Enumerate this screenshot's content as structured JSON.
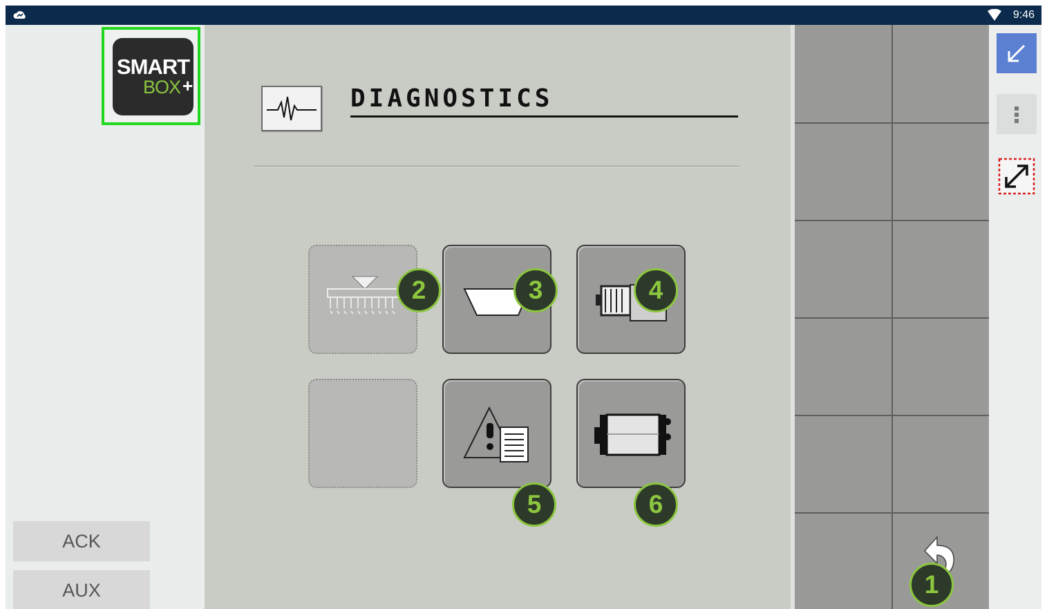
{
  "status_bar": {
    "time": "9:46",
    "cloud_icon": "cloud-icon",
    "wifi_icon": "wifi-icon"
  },
  "logo": {
    "line1": "SMART",
    "line2": "BOX",
    "plus": "+"
  },
  "soft_keys": [
    {
      "label": "ACK"
    },
    {
      "label": "AUX"
    }
  ],
  "page": {
    "title": "DIAGNOSTICS",
    "icon": "pulse-waveform-icon"
  },
  "tiles": [
    {
      "icon": "seed-drill-icon",
      "badge": "2",
      "enabled": false
    },
    {
      "icon": "hopper-icon",
      "badge": "3",
      "enabled": true
    },
    {
      "icon": "metering-motor-icon",
      "badge": "4",
      "enabled": true
    },
    {
      "icon": "empty-slot",
      "badge": "",
      "enabled": false
    },
    {
      "icon": "alarm-log-icon",
      "badge": "5",
      "enabled": true
    },
    {
      "icon": "roller-icon",
      "badge": "6",
      "enabled": true
    }
  ],
  "right_panel": {
    "back_icon": "back-arrow-icon",
    "back_badge": "1"
  },
  "toolbar": {
    "minimize_icon": "minimize-arrow-icon",
    "menu_icon": "more-vertical-icon",
    "resize_icon": "resize-icon"
  },
  "colors": {
    "accent_green": "#8cc63f",
    "highlight_green": "#22d81e",
    "status_bar": "#0b2a4c",
    "toolbar_blue": "#5b7fd1"
  }
}
